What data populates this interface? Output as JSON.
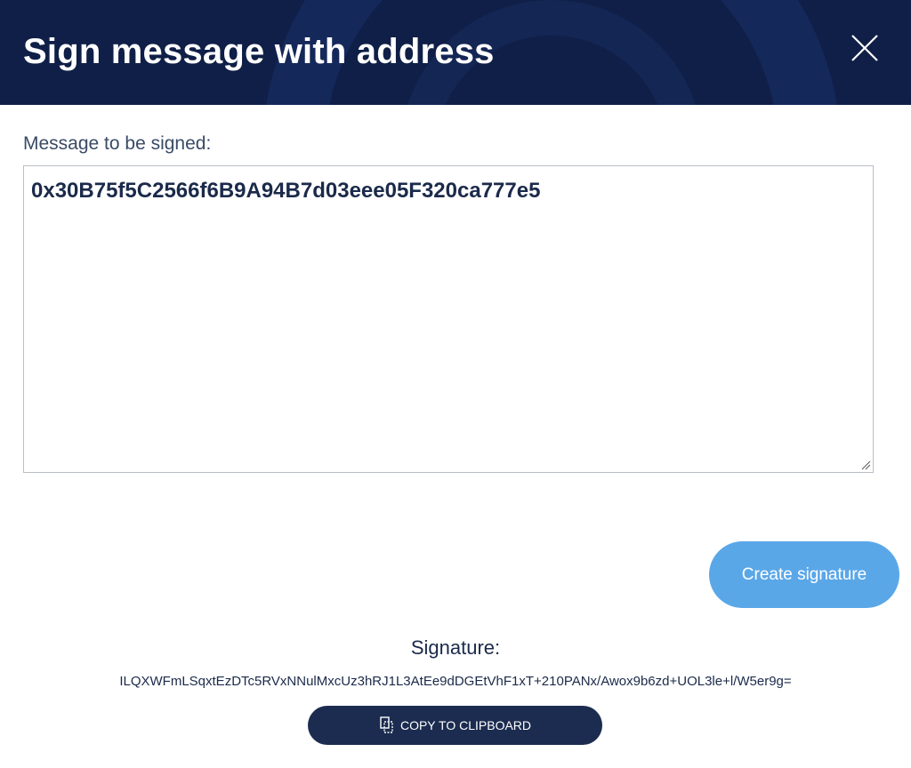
{
  "dialog": {
    "title": "Sign message with address",
    "close_icon": "close-icon"
  },
  "message": {
    "label": "Message to be signed:",
    "value": "0x30B75f5C2566f6B9A94B7d03eee05F320ca777e5"
  },
  "actions": {
    "create_label": "Create signature"
  },
  "signature": {
    "label": "Signature:",
    "value": "ILQXWFmLSqxtEzDTc5RVxNNulMxcUz3hRJ1L3AtEe9dDGEtVhF1xT+210PANx/Awox9b6zd+UOL3le+l/W5er9g=",
    "copy_label": "COPY TO CLIPBOARD",
    "copy_icon": "clipboard-icon"
  },
  "colors": {
    "header_bg": "#0f1f47",
    "primary_button": "#5aa7e8",
    "copy_button": "#1c2c50",
    "text": "#1b2a4a"
  }
}
